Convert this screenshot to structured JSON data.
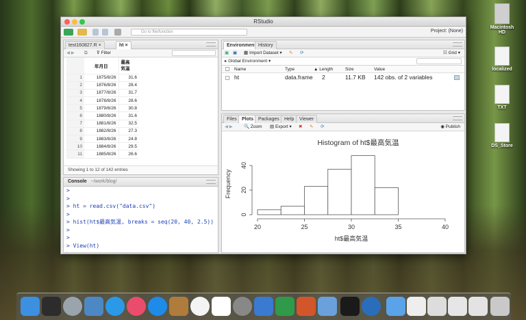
{
  "window": {
    "title": "RStudio"
  },
  "toolbar": {
    "goto_placeholder": "Go to file/function",
    "project": "Project: (None)"
  },
  "source": {
    "tabs": [
      "test160827.R",
      "ht"
    ],
    "filter_label": "Filter",
    "col_date": "年月日",
    "col_temp": "最高\n気温",
    "rows": [
      [
        "1",
        "1875/8/26",
        "31.6"
      ],
      [
        "2",
        "1876/8/26",
        "28.4"
      ],
      [
        "3",
        "1877/8/26",
        "31.7"
      ],
      [
        "4",
        "1878/8/26",
        "28.6"
      ],
      [
        "5",
        "1879/8/26",
        "30.8"
      ],
      [
        "6",
        "1880/8/26",
        "31.6"
      ],
      [
        "7",
        "1881/8/26",
        "32.5"
      ],
      [
        "8",
        "1882/8/26",
        "27.3"
      ],
      [
        "9",
        "1883/8/26",
        "24.8"
      ],
      [
        "10",
        "1884/8/26",
        "29.5"
      ],
      [
        "11",
        "1885/8/26",
        "26.6"
      ]
    ],
    "footer": "Showing 1 to 12 of 142 entries"
  },
  "console": {
    "title": "Console",
    "path": "~/work/blog/",
    "lines": [
      ">",
      ">",
      "> ht = read.csv(\"data.csv\")",
      ">",
      "> hist(ht$最高気温, breaks = seq(20, 40, 2.5))",
      ">",
      ">",
      "> View(ht)",
      ">"
    ]
  },
  "env": {
    "tabs": [
      "Environment",
      "History"
    ],
    "import_label": "Import Dataset",
    "grid_label": "Grid",
    "scope": "Global Environment",
    "headers": [
      "Name",
      "Type",
      "Length",
      "Size",
      "Value"
    ],
    "row": {
      "name": "ht",
      "type": "data.frame",
      "length": "2",
      "size": "11.7 KB",
      "value": "142 obs. of 2 variables"
    }
  },
  "files": {
    "tabs": [
      "Files",
      "Plots",
      "Packages",
      "Help",
      "Viewer"
    ],
    "zoom": "Zoom",
    "export": "Export",
    "publish": "Publish"
  },
  "desktop": {
    "icons": [
      "Macintosh HD",
      "localized",
      "TXT",
      "DS_Store"
    ]
  },
  "chart_data": {
    "type": "bar",
    "title": "Histogram of ht$最高気温",
    "xlabel": "ht$最高気温",
    "ylabel": "Frequency",
    "bins": [
      [
        20,
        22.5
      ],
      [
        22.5,
        25
      ],
      [
        25,
        27.5
      ],
      [
        27.5,
        30
      ],
      [
        30,
        32.5
      ],
      [
        32.5,
        35
      ]
    ],
    "values": [
      4,
      7,
      23,
      37,
      48,
      22
    ],
    "xticks": [
      20,
      25,
      30,
      35,
      40
    ],
    "yticks": [
      0,
      20,
      40
    ],
    "xlim": [
      20,
      40
    ],
    "ylim": [
      0,
      50
    ]
  },
  "colors": {
    "tab_active": "#ffffff",
    "console_text": "#1a3fb5"
  }
}
